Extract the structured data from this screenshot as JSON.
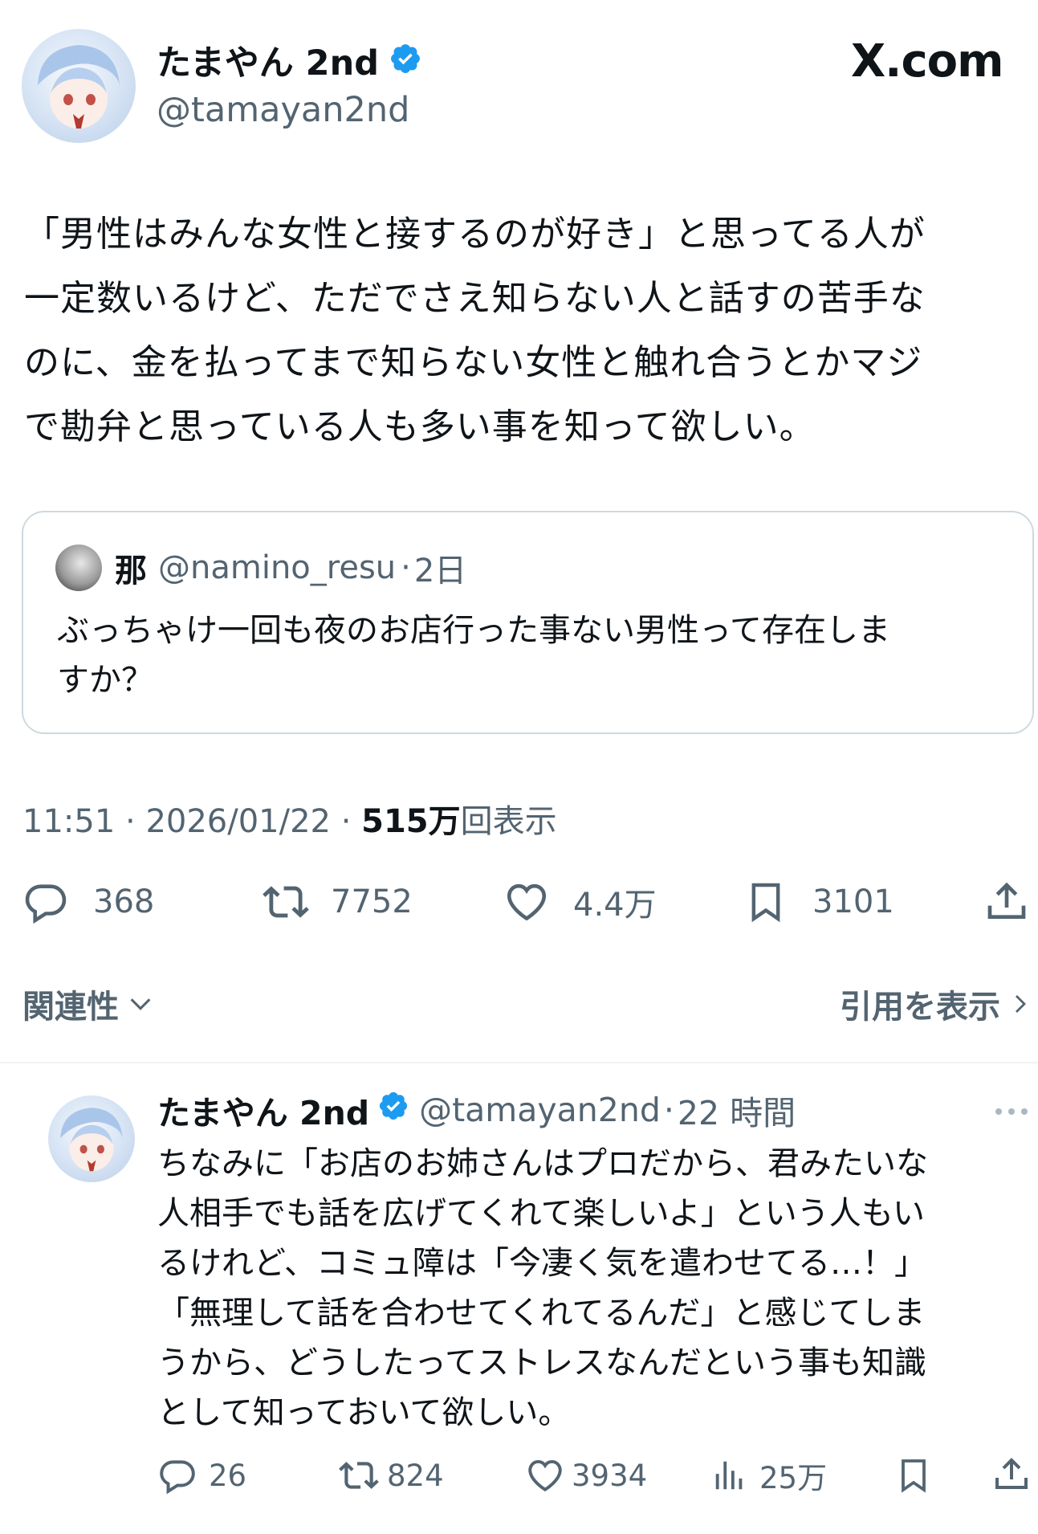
{
  "header": {
    "display_name": "たまやん 2nd",
    "handle": "@tamayan2nd",
    "watermark": "X.com",
    "verified": true
  },
  "main_post": {
    "text": "「男性はみんな女性と接するのが好き」と思ってる人が\n一定数いるけど、ただでさえ知らない人と話すの苦手な\nのに、金を払ってまで知らない女性と触れ合うとかマジ\nで勘弁と思っている人も多い事を知って欲しい。"
  },
  "quote": {
    "name": "那",
    "handle": "@namino_resu",
    "separator": "·",
    "age": "2日",
    "text": "ぶっちゃけ一回も夜のお店行った事ない男性って存在しま\nすか？"
  },
  "meta": {
    "time": "11:51",
    "sep1": "·",
    "date": "2026/01/22",
    "sep2": "·",
    "views_count": "515万",
    "views_label": "回表示"
  },
  "actions": {
    "replies": "368",
    "reposts": "7752",
    "likes": "4.4万",
    "bookmarks": "3101"
  },
  "sort": {
    "label": "関連性",
    "quotes_link": "引用を表示"
  },
  "reply_post": {
    "display_name": "たまやん 2nd",
    "handle": "@tamayan2nd",
    "separator": "·",
    "age": "22 時間",
    "text": "ちなみに「お店のお姉さんはプロだから、君みたいな\n人相手でも話を広げてくれて楽しいよ」という人もい\nるけれど、コミュ障は「今凄く気を遣わせてる…！」\n「無理して話を合わせてくれてるんだ」と感じてしま\nうから、どうしたってストレスなんだという事も知識\nとして知っておいて欲しい。",
    "replies": "26",
    "reposts": "824",
    "likes": "3934",
    "views": "25万"
  },
  "colors": {
    "verified": "#1d9bf0",
    "text": "#0f1419",
    "muted": "#536471",
    "border": "#cfd9de"
  }
}
